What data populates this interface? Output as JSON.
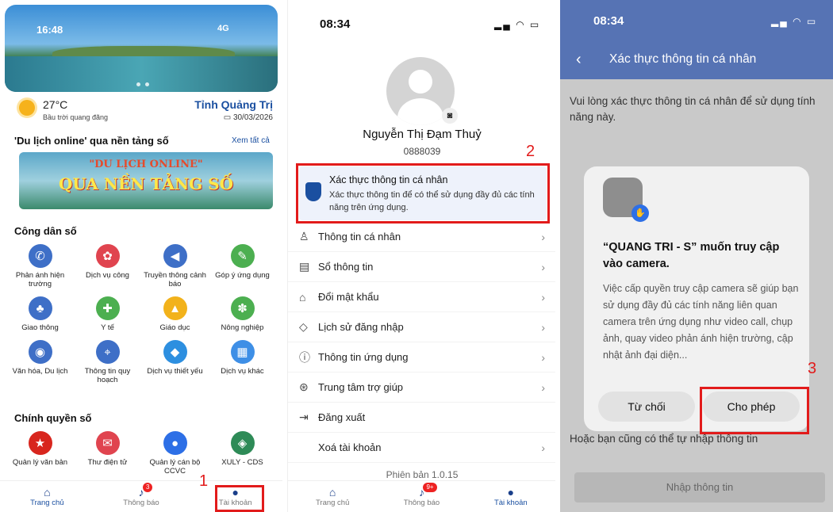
{
  "panel1": {
    "status": {
      "time": "16:48",
      "network": "4G"
    },
    "weather": {
      "temp": "27°C",
      "condition": "Bầu trời quang đãng",
      "province": "Tỉnh Quảng Trị",
      "date": "30/03/2026"
    },
    "tourism": {
      "title": "'Du lịch online' qua nền tảng số",
      "see_all": "Xem tất cả",
      "banner_line1": "\"DU LỊCH ONLINE\"",
      "banner_line2": "QUA NỀN TẢNG SỐ"
    },
    "citizen_section": "Công dân số",
    "citizen": [
      {
        "label": "Phản ánh hiện trường",
        "icon": "feedback-icon",
        "color": "#3e6fc7"
      },
      {
        "label": "Dịch vụ công",
        "icon": "public-service-icon",
        "color": "#e0444f"
      },
      {
        "label": "Truyền thông cảnh báo",
        "icon": "megaphone-icon",
        "color": "#3e6fc7"
      },
      {
        "label": "Góp ý ứng dụng",
        "icon": "comment-icon",
        "color": "#4caf50"
      },
      {
        "label": "Giao thông",
        "icon": "traffic-icon",
        "color": "#3e6fc7"
      },
      {
        "label": "Y tế",
        "icon": "health-icon",
        "color": "#4caf50"
      },
      {
        "label": "Giáo dục",
        "icon": "graduation-icon",
        "color": "#f2b21b"
      },
      {
        "label": "Nông nghiệp",
        "icon": "agriculture-icon",
        "color": "#4caf50"
      },
      {
        "label": "Văn hóa, Du lịch",
        "icon": "globe-icon",
        "color": "#3e6fc7"
      },
      {
        "label": "Thông tin quy hoạch",
        "icon": "map-icon",
        "color": "#3e6fc7"
      },
      {
        "label": "Dịch vụ thiết yếu",
        "icon": "water-icon",
        "color": "#2d8fe0"
      },
      {
        "label": "Dịch vụ khác",
        "icon": "grid-icon",
        "color": "#3e8fe6"
      }
    ],
    "gov_section": "Chính quyền số",
    "gov": [
      {
        "label": "Quản lý văn bản",
        "icon": "emblem-icon",
        "color": "#d8261e"
      },
      {
        "label": "Thư điện tử",
        "icon": "mail-icon",
        "color": "#e0444f"
      },
      {
        "label": "Quản lý cán bộ CCVC",
        "icon": "person-icon",
        "color": "#2d6fe6"
      },
      {
        "label": "XULY - CDS",
        "icon": "cds-logo-icon",
        "color": "#2e8b57"
      }
    ],
    "nav": [
      {
        "label": "Trang chủ",
        "icon": "home-icon"
      },
      {
        "label": "Thông báo",
        "icon": "bell-icon",
        "badge": "3"
      },
      {
        "label": "Tài khoản",
        "icon": "account-icon"
      }
    ],
    "step": "1"
  },
  "panel2": {
    "status": {
      "time": "08:34"
    },
    "name": "Nguyễn Thị Đạm Thuỷ",
    "phone": "0888039",
    "step": "2",
    "verify": {
      "title": "Xác thực thông tin cá nhân",
      "desc": "Xác thực thông tin để có thể sử dụng đầy đủ các tính năng trên ứng dụng."
    },
    "menu": [
      {
        "label": "Thông tin cá nhân",
        "icon": "person-outline-icon",
        "glyph": "♙",
        "chevron": true
      },
      {
        "label": "Sổ thông tin",
        "icon": "book-icon",
        "glyph": "▤",
        "chevron": true
      },
      {
        "label": "Đổi mật khẩu",
        "icon": "lock-icon",
        "glyph": "⌂",
        "chevron": true
      },
      {
        "label": "Lịch sử đăng nhập",
        "icon": "shield-outline-icon",
        "glyph": "◇",
        "chevron": true
      },
      {
        "label": "Thông tin ứng dụng",
        "icon": "info-icon",
        "glyph": "ⓘ",
        "chevron": true
      },
      {
        "label": "Trung tâm trợ giúp",
        "icon": "help-icon",
        "glyph": "⊛",
        "chevron": true
      },
      {
        "label": "Đăng xuất",
        "icon": "logout-icon",
        "glyph": "⇥",
        "chevron": false
      },
      {
        "label": "Xoá tài khoản",
        "icon": "",
        "glyph": "",
        "chevron": true
      }
    ],
    "version": "Phiên bản 1.0.15",
    "nav": [
      {
        "label": "Trang chủ",
        "icon": "home-icon"
      },
      {
        "label": "Thông báo",
        "icon": "bell-icon",
        "badge": "9+"
      },
      {
        "label": "Tài khoản",
        "icon": "account-icon"
      }
    ]
  },
  "panel3": {
    "status": {
      "time": "08:34"
    },
    "header_title": "Xác thực thông tin cá nhân",
    "intro": "Vui lòng xác thực thông tin cá nhân để sử dụng tính năng này.",
    "dialog": {
      "title": "“QUANG TRI - S” muốn truy cập vào camera.",
      "body": "Việc cấp quyền truy cập camera sẽ giúp bạn sử dụng đầy đủ các tính năng liên quan camera trên ứng dụng như video call, chụp ảnh, quay video phản ánh hiện trường, cập nhật ảnh đại diện...",
      "deny": "Từ chối",
      "allow": "Cho phép"
    },
    "step": "3",
    "under": "Hoặc bạn cũng có thể tự nhập thông tin",
    "entry_button": "Nhập thông tin"
  }
}
